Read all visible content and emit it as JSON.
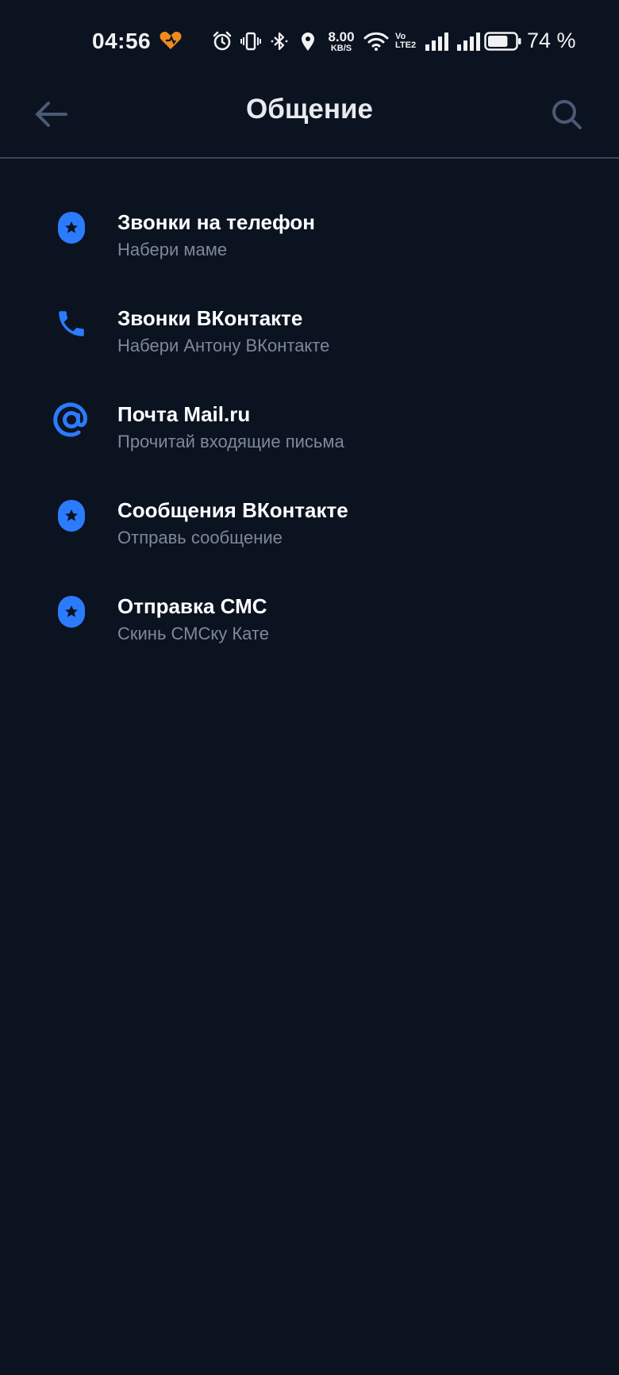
{
  "status_bar": {
    "time": "04:56",
    "speed_value": "8.00",
    "speed_unit": "KB/S",
    "volte_top": "Vo",
    "volte_bottom": "LTE2",
    "battery_percent": "74 %",
    "battery_level": 0.74,
    "icons": [
      "app-notification-icon",
      "alarm-icon",
      "vibrate-icon",
      "bluetooth-icon",
      "location-icon",
      "wifi-icon",
      "signal-icon",
      "signal-icon",
      "battery-icon"
    ]
  },
  "header": {
    "title": "Общение",
    "back_icon": "arrow-left-icon",
    "search_icon": "search-icon"
  },
  "colors": {
    "background": "#0b1321",
    "accent": "#2b7bff",
    "title_text": "#e8eaf0",
    "subtitle_text": "#7f8898",
    "header_icons": "#4a5a72"
  },
  "items": [
    {
      "title": "Звонки на телефон",
      "subtitle": "Набери маме",
      "icon": "star-badge-icon"
    },
    {
      "title": "Звонки ВКонтакте",
      "subtitle": "Набери Антону ВКонтакте",
      "icon": "phone-icon"
    },
    {
      "title": "Почта Mail.ru",
      "subtitle": "Прочитай входящие письма",
      "icon": "at-sign-icon"
    },
    {
      "title": "Сообщения ВКонтакте",
      "subtitle": "Отправь сообщение",
      "icon": "star-badge-icon"
    },
    {
      "title": "Отправка СМС",
      "subtitle": "Скинь СМСку Кате",
      "icon": "star-badge-icon"
    }
  ]
}
